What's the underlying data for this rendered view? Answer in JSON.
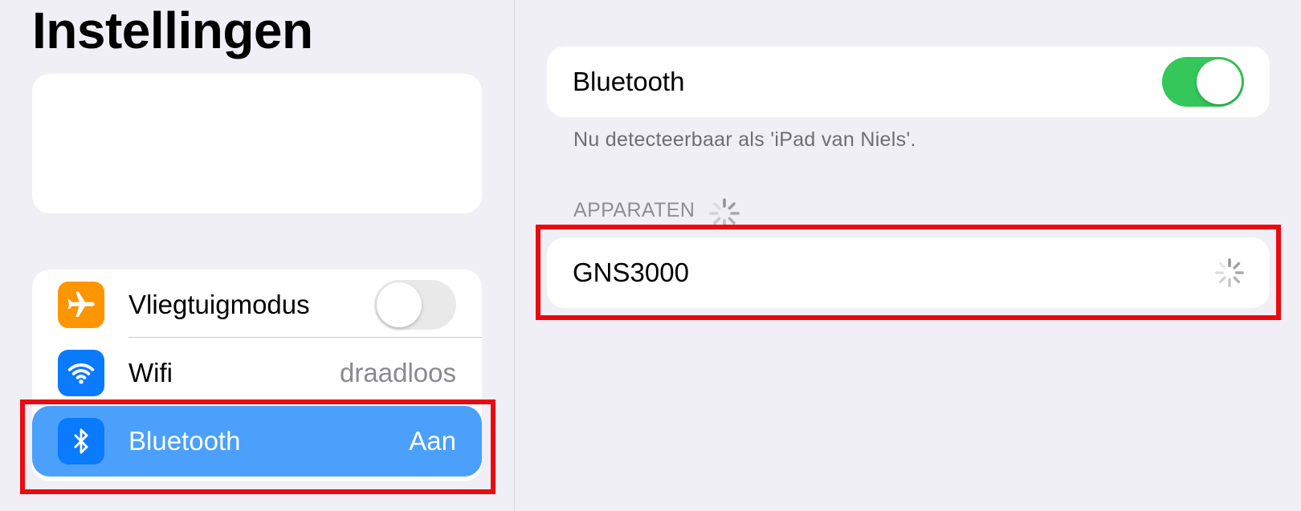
{
  "sidebar": {
    "title": "Instellingen",
    "items": [
      {
        "label": "Vliegtuigmodus",
        "value": "",
        "toggle": "off",
        "icon": "airplane-icon",
        "icon_color": "#ff9500"
      },
      {
        "label": "Wifi",
        "value": "draadloos",
        "icon": "wifi-icon",
        "icon_color": "#0a7aff"
      },
      {
        "label": "Bluetooth",
        "value": "Aan",
        "icon": "bluetooth-icon",
        "icon_color": "#0a7aff",
        "selected": true
      }
    ]
  },
  "detail": {
    "bluetooth_label": "Bluetooth",
    "bluetooth_toggle": "on",
    "discoverable_text": "Nu detecteerbaar als 'iPad van Niels'.",
    "devices_header": "APPARATEN",
    "devices": [
      {
        "name": "GNS3000",
        "status": "connecting-spinner"
      }
    ]
  },
  "colors": {
    "background": "#f0eff5",
    "selected_row": "#4aa0fb",
    "toggle_on": "#34c759",
    "highlight_box": "#ea0a10"
  }
}
